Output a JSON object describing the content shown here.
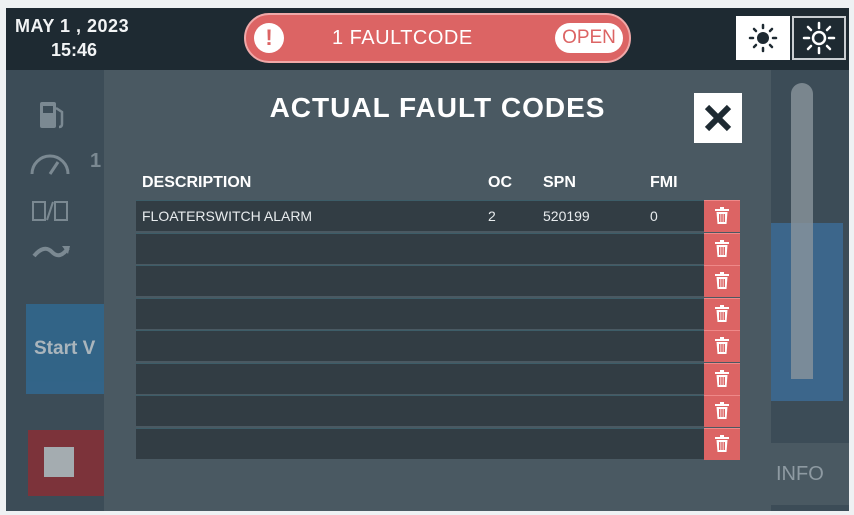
{
  "status_bar": {
    "date": "MAY  1 , 2023",
    "time": "15:46",
    "fault_alert_icon": "exclamation-icon",
    "fault_count_text": "1 FAULTCODE",
    "open_label": "OPEN",
    "brightness_icons": [
      "sun-low-icon",
      "sun-high-icon"
    ]
  },
  "background": {
    "start_label": "Start V",
    "info_label": "INFO",
    "icons": [
      "fuel-pump-icon",
      "gauge-icon",
      "valve-icon",
      "flow-icon"
    ],
    "partial_values": [
      "1"
    ]
  },
  "modal": {
    "title": "ACTUAL FAULT CODES",
    "close_icon": "close-icon",
    "columns": [
      "DESCRIPTION",
      "OC",
      "SPN",
      "FMI"
    ],
    "rows": [
      {
        "description": "FLOATERSWITCH ALARM",
        "oc": "2",
        "spn": "520199",
        "fmi": "0"
      },
      {
        "description": "",
        "oc": "",
        "spn": "",
        "fmi": ""
      },
      {
        "description": "",
        "oc": "",
        "spn": "",
        "fmi": ""
      },
      {
        "description": "",
        "oc": "",
        "spn": "",
        "fmi": ""
      },
      {
        "description": "",
        "oc": "",
        "spn": "",
        "fmi": ""
      },
      {
        "description": "",
        "oc": "",
        "spn": "",
        "fmi": ""
      },
      {
        "description": "",
        "oc": "",
        "spn": "",
        "fmi": ""
      },
      {
        "description": "",
        "oc": "",
        "spn": "",
        "fmi": ""
      }
    ],
    "delete_icon": "trash-icon"
  },
  "colors": {
    "alert_red": "#dc6464",
    "panel": "#4a5962",
    "row_bg": "#323d44",
    "topbar": "#1e2a32"
  }
}
